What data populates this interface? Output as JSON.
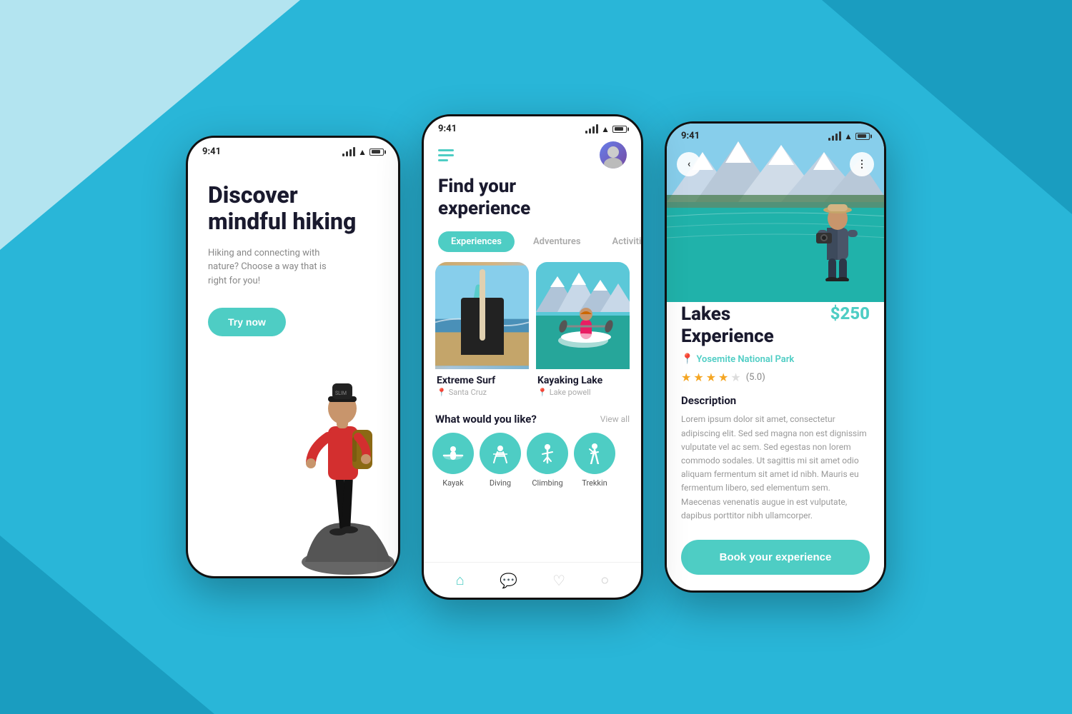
{
  "background": {
    "color": "#29b6d8"
  },
  "phone1": {
    "status_time": "9:41",
    "title_line1": "Discover",
    "title_line2": "mindful hiking",
    "subtitle": "Hiking and connecting with nature? Choose a way that is right for you!",
    "cta_button": "Try now"
  },
  "phone2": {
    "status_time": "9:41",
    "header_title_line1": "Find your",
    "header_title_line2": "experience",
    "tabs": [
      {
        "label": "Experiences",
        "active": true
      },
      {
        "label": "Adventures",
        "active": false
      },
      {
        "label": "Activities",
        "active": false
      }
    ],
    "cards": [
      {
        "title": "Extreme Surf",
        "location": "Santa Cruz",
        "type": "surf"
      },
      {
        "title": "Kayaking Lake",
        "location": "Lake powell",
        "type": "kayak"
      }
    ],
    "section_label": "What would you like?",
    "view_all": "View all",
    "activities": [
      {
        "label": "Kayak",
        "icon": "🚣"
      },
      {
        "label": "Diving",
        "icon": "🤿"
      },
      {
        "label": "Climbing",
        "icon": "🧗"
      },
      {
        "label": "Trekkin",
        "icon": "🥾"
      }
    ],
    "nav_items": [
      "home",
      "chat",
      "heart",
      "search"
    ]
  },
  "phone3": {
    "status_time": "9:41",
    "experience_title_line1": "Lakes",
    "experience_title_line2": "Experience",
    "price": "$250",
    "location": "Yosemite National Park",
    "rating": "(5.0)",
    "stars": [
      true,
      true,
      true,
      true,
      false
    ],
    "description_title": "Description",
    "description_text": "Lorem ipsum dolor sit amet, consectetur adipiscing elit. Sed sed magna non est dignissim vulputate vel ac sem. Sed egestas non lorem commodo sodales. Ut sagittis mi sit amet odio aliquam fermentum sit amet id nibh. Mauris eu fermentum libero, sed elementum sem. Maecenas venenatis augue in est vulputate, dapibus porttitor nibh ullamcorper.",
    "book_button": "Book your experience",
    "back_button": "‹",
    "more_button": "⋮"
  }
}
